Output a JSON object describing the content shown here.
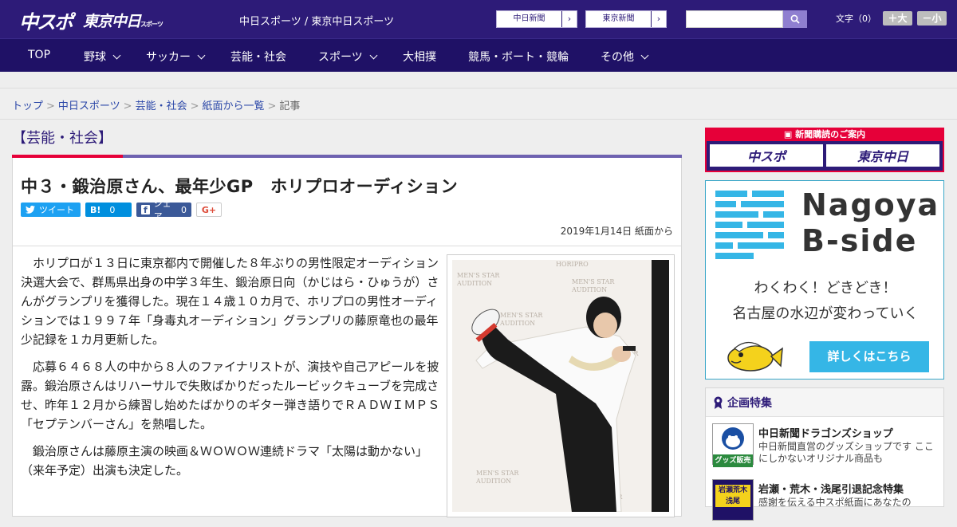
{
  "header": {
    "logo_main": "中スポ",
    "logo_tokyo": "東京中日",
    "logo_tokyo_sub": "スポーツ",
    "site_links": "中日スポーツ / 東京中日スポーツ",
    "ext_links": [
      "中日新聞",
      "東京新聞"
    ],
    "search_placeholder": "",
    "font_label": "文字（0）",
    "font_larger": "＋大",
    "font_smaller": "－小"
  },
  "nav": {
    "items": [
      {
        "label": "TOP",
        "dropdown": false
      },
      {
        "label": "野球",
        "dropdown": true
      },
      {
        "label": "サッカー",
        "dropdown": true
      },
      {
        "label": "芸能・社会",
        "dropdown": false
      },
      {
        "label": "スポーツ",
        "dropdown": true
      },
      {
        "label": "大相撲",
        "dropdown": false
      },
      {
        "label": "競馬・ボート・競輪",
        "dropdown": false
      },
      {
        "label": "その他",
        "dropdown": true
      }
    ]
  },
  "breadcrumb": {
    "items": [
      "トップ",
      "中日スポーツ",
      "芸能・社会",
      "紙面から一覧"
    ],
    "current": "記事"
  },
  "article": {
    "category": "【芸能・社会】",
    "headline": "中３・鍛治原さん、最年少GP　ホリプロオーディション",
    "share": {
      "tweet": "ツイート",
      "hatena": "B!",
      "hatena_count": "0",
      "facebook": "シェア",
      "facebook_count": "0",
      "gplus": "G+"
    },
    "date": "2019年1月14日 紙面から",
    "paragraphs": [
      "ホリプロが１３日に東京都内で開催した８年ぶりの男性限定オーディション決選大会で、群馬県出身の中学３年生、鍛治原日向（かじはら・ひゅうが）さんがグランプリを獲得した。現在１４歳１０カ月で、ホリプロの男性オーディションでは１９９７年「身毒丸オーディション」グランプリの藤原竜也の最年少記録を１カ月更新した。",
      "応募６４６８人の中から８人のファイナリストが、演技や自己アピールを披露。鍛治原さんはリハーサルで失敗ばかりだったルービックキューブを完成させ、昨年１２月から練習し始めたばかりのギター弾き語りでＲＡＤＷＩＭＰＳ「セプテンバーさん」を熱唱した。",
      "鍛治原さんは藤原主演の映画＆ＷＯＷＯＷ連続ドラマ「太陽は動かない」（来年予定）出演も決定した。"
    ],
    "photo_backdrop_text": [
      "HORIPRO",
      "MEN'S STAR",
      "AUDITION"
    ]
  },
  "sidebar": {
    "subscribe_head": "新聞購読のご案内",
    "subscribe_logos": [
      "中スポ",
      "東京中日"
    ],
    "bside": {
      "title_line1": "Nagoya",
      "title_line2": "B-side",
      "tag_line1": "わくわく！どきどき！",
      "tag_line2": "名古屋の水辺が変わっていく",
      "button": "詳しくはこちら"
    },
    "features": {
      "head": "企画特集",
      "items": [
        {
          "title": "中日新聞ドラゴンズショップ",
          "desc": "中日新聞直営のグッズショップです ここにしかないオリジナル商品も",
          "thumb_text": "グッズ販売中"
        },
        {
          "title": "岩瀬・荒木・浅尾引退記念特集",
          "desc": "感謝を伝える中スポ紙面にあなたの",
          "thumb_text": "岩瀬荒木浅尾"
        }
      ]
    }
  },
  "colors": {
    "header_bg": "#2d1b78",
    "nav_bg": "#1f1166",
    "accent_red": "#e60039",
    "bside_blue": "#35b6e6"
  }
}
